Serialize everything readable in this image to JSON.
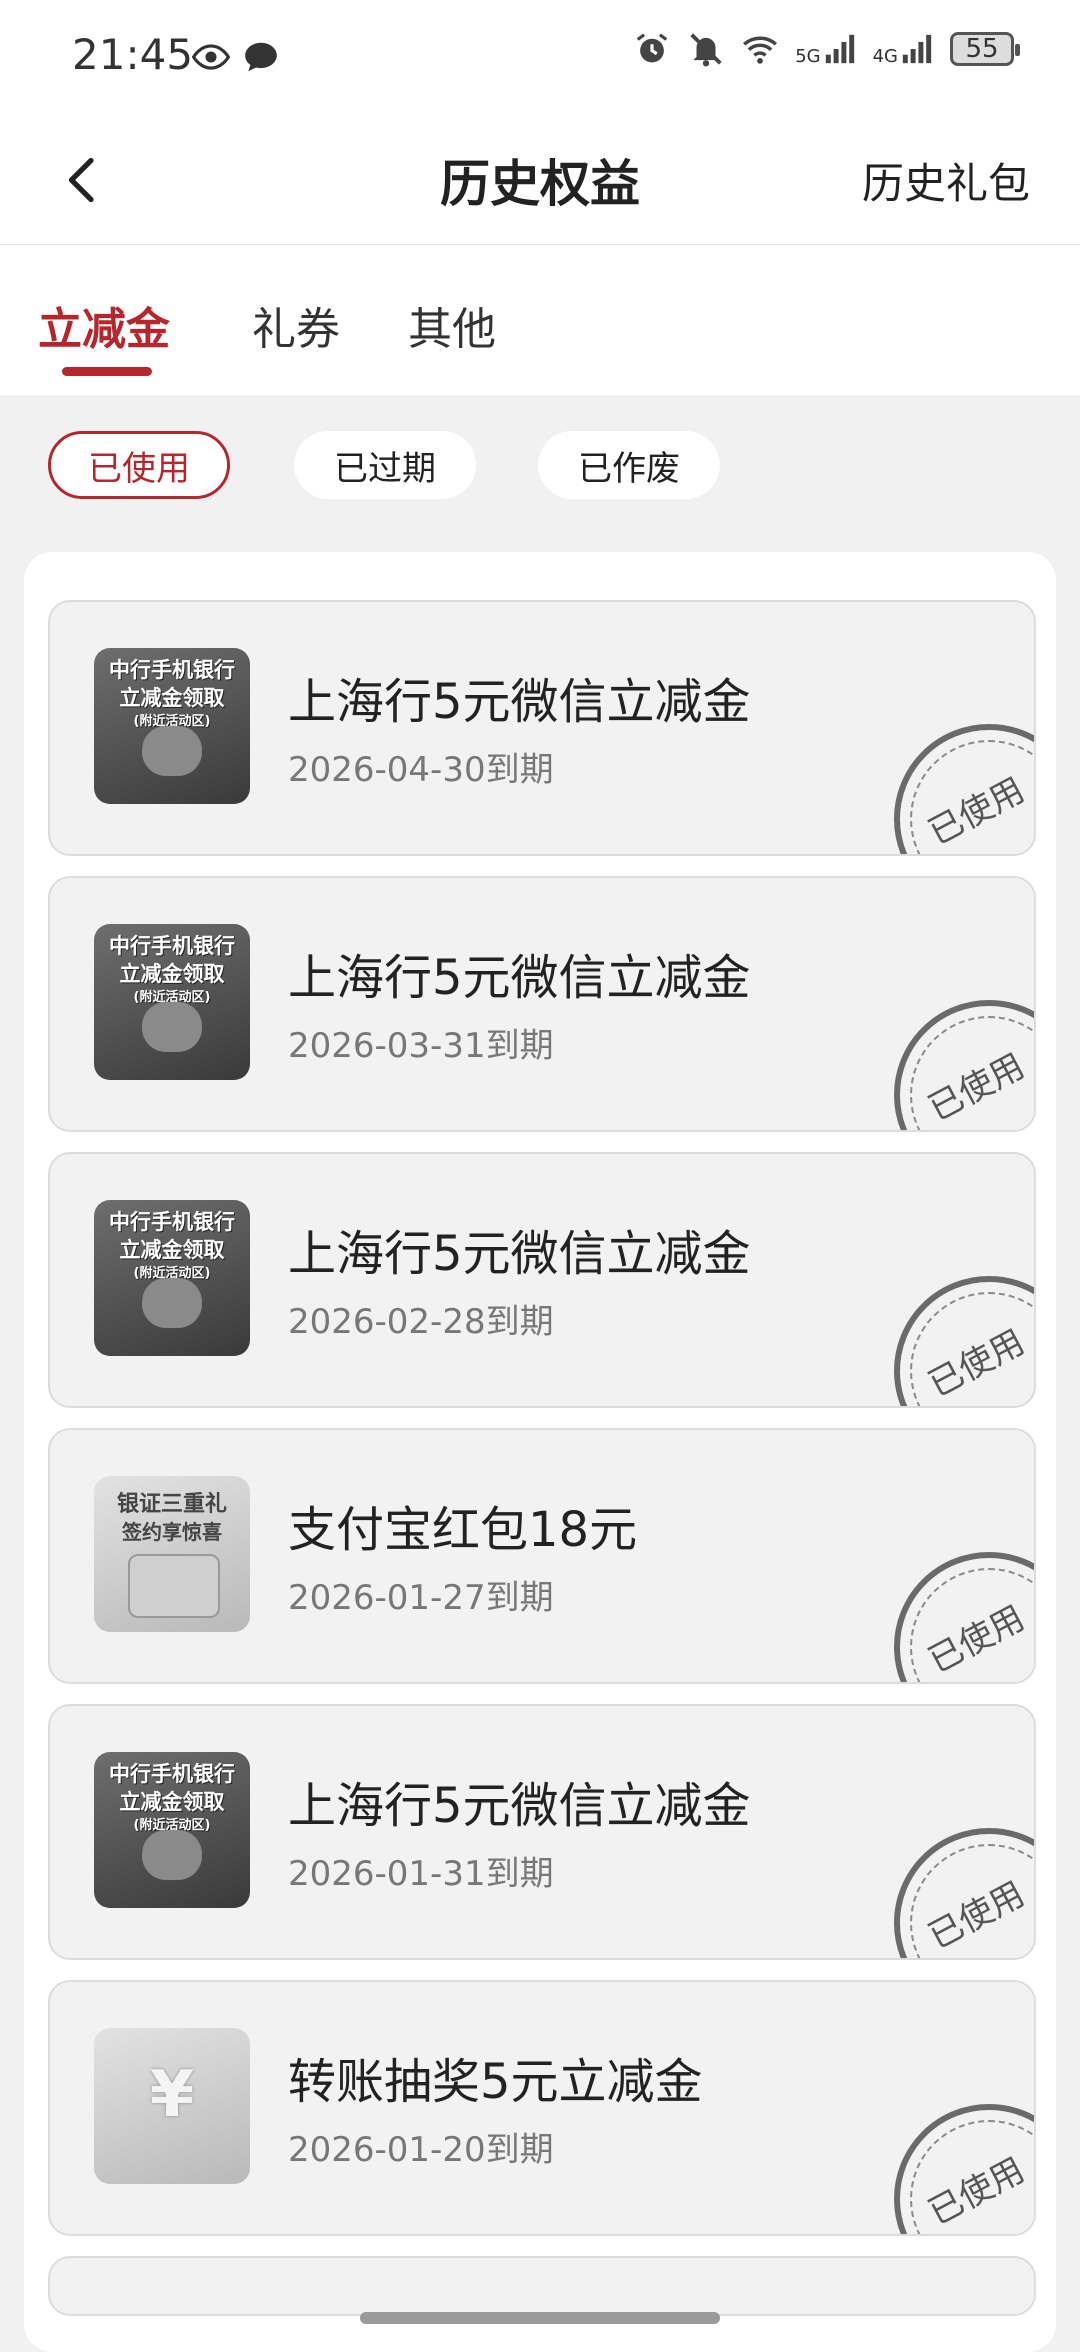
{
  "status_bar": {
    "time": "21:45",
    "left_icons": [
      "eye-icon",
      "chat-bubble-icon"
    ],
    "right_icons": [
      "alarm-icon",
      "bell-muted-icon",
      "wifi-icon",
      "signal-5g-icon",
      "signal-4g-icon"
    ],
    "net_5g": "5G",
    "net_4g": "4G",
    "battery": "55"
  },
  "header": {
    "title": "历史权益",
    "right_link": "历史礼包"
  },
  "tabs": [
    {
      "label": "立减金",
      "active": true
    },
    {
      "label": "礼券",
      "active": false
    },
    {
      "label": "其他",
      "active": false
    }
  ],
  "filters": [
    {
      "label": "已使用",
      "selected": true
    },
    {
      "label": "已过期",
      "selected": false
    },
    {
      "label": "已作废",
      "selected": false
    }
  ],
  "items": [
    {
      "title": "上海行5元微信立减金",
      "date": "2026-04-30到期",
      "stamp": "已使用",
      "thumb_lines": [
        "中行手机银行",
        "立减金领取",
        "(附近活动区)"
      ],
      "thumb_style": "dark"
    },
    {
      "title": "上海行5元微信立减金",
      "date": "2026-03-31到期",
      "stamp": "已使用",
      "thumb_lines": [
        "中行手机银行",
        "立减金领取",
        "(附近活动区)"
      ],
      "thumb_style": "dark"
    },
    {
      "title": "上海行5元微信立减金",
      "date": "2026-02-28到期",
      "stamp": "已使用",
      "thumb_lines": [
        "中行手机银行",
        "立减金领取",
        "(附近活动区)"
      ],
      "thumb_style": "dark"
    },
    {
      "title": "支付宝红包18元",
      "date": "2026-01-27到期",
      "stamp": "已使用",
      "thumb_lines": [
        "银证三重礼",
        "签约享惊喜"
      ],
      "thumb_style": "light"
    },
    {
      "title": "上海行5元微信立减金",
      "date": "2026-01-31到期",
      "stamp": "已使用",
      "thumb_lines": [
        "中行手机银行",
        "立减金领取",
        "(附近活动区)"
      ],
      "thumb_style": "dark"
    },
    {
      "title": "转账抽奖5元立减金",
      "date": "2026-01-20到期",
      "stamp": "已使用",
      "thumb_lines": [
        "¥"
      ],
      "thumb_style": "light"
    }
  ],
  "colors": {
    "accent": "#b5272d",
    "background": "#f1f1f1",
    "card": "#f2f2f2"
  }
}
